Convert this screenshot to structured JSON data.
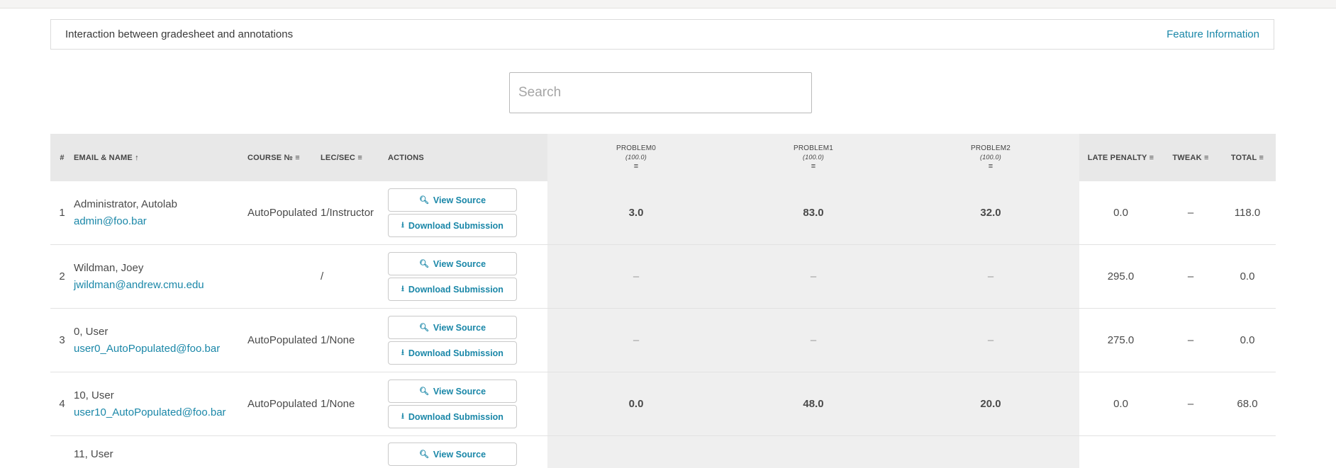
{
  "banner": {
    "title": "Interaction between gradesheet and annotations",
    "link": "Feature Information"
  },
  "search": {
    "placeholder": "Search",
    "value": ""
  },
  "table": {
    "headers": {
      "index": "#",
      "email_name": "EMAIL & NAME",
      "course": "COURSE №",
      "lecsec": "LEC/SEC",
      "actions": "ACTIONS",
      "problems": [
        {
          "name": "PROBLEM0",
          "max": "(100.0)"
        },
        {
          "name": "PROBLEM1",
          "max": "(100.0)"
        },
        {
          "name": "PROBLEM2",
          "max": "(100.0)"
        }
      ],
      "late_penalty": "LATE PENALTY",
      "tweak": "TWEAK",
      "total": "TOTAL"
    },
    "sort_icons": {
      "asc": "↑",
      "sort": "≡"
    },
    "view_source_label": "View Source",
    "download_label": "Download Submission",
    "rows": [
      {
        "index": "1",
        "name": "Administrator, Autolab",
        "email": "admin@foo.bar",
        "course": "AutoPopulated",
        "lecsec": "1/Instructor",
        "problems": [
          "3.0",
          "83.0",
          "32.0"
        ],
        "late_penalty": "0.0",
        "tweak": "–",
        "total": "118.0"
      },
      {
        "index": "2",
        "name": "Wildman, Joey",
        "email": "jwildman@andrew.cmu.edu",
        "course": "",
        "lecsec": "/",
        "problems": [
          "–",
          "–",
          "–"
        ],
        "late_penalty": "295.0",
        "tweak": "–",
        "total": "0.0"
      },
      {
        "index": "3",
        "name": "0, User",
        "email": "user0_AutoPopulated@foo.bar",
        "course": "AutoPopulated",
        "lecsec": "1/None",
        "problems": [
          "–",
          "–",
          "–"
        ],
        "late_penalty": "275.0",
        "tweak": "–",
        "total": "0.0"
      },
      {
        "index": "4",
        "name": "10, User",
        "email": "user10_AutoPopulated@foo.bar",
        "course": "AutoPopulated",
        "lecsec": "1/None",
        "problems": [
          "0.0",
          "48.0",
          "20.0"
        ],
        "late_penalty": "0.0",
        "tweak": "–",
        "total": "68.0"
      },
      {
        "index": "",
        "name": "11, User"
      }
    ]
  },
  "colors": {
    "link": "#1a87a8",
    "header_bg": "#e8e8e8",
    "problem_bg": "#efefef"
  }
}
